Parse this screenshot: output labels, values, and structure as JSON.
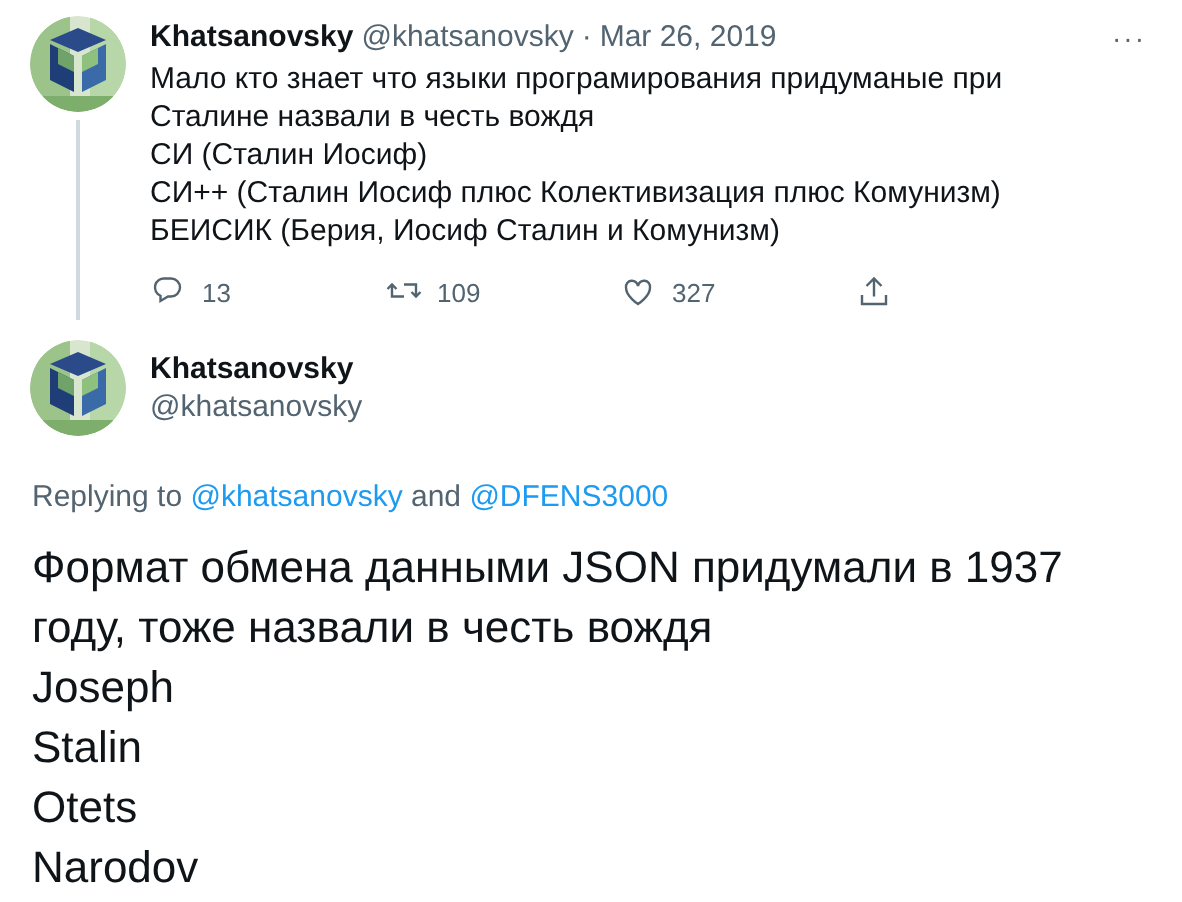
{
  "tweet": {
    "name": "Khatsanovsky",
    "handle": "@khatsanovsky",
    "separator": "·",
    "date": "Mar 26, 2019",
    "more": "···",
    "lines": [
      "Мало кто знает что языки програмирования придуманые при Сталине назвали в честь вождя",
      "СИ  (Сталин Иосиф)",
      "СИ++ (Сталин Иосиф плюс Колективизация плюс Комунизм)",
      "БЕИСИК (Берия, Иосиф Сталин и Комунизм)"
    ],
    "actions": [
      {
        "kind": "reply",
        "count": "13"
      },
      {
        "kind": "retweet",
        "count": "109"
      },
      {
        "kind": "like",
        "count": "327"
      },
      {
        "kind": "share"
      }
    ]
  },
  "reply": {
    "name": "Khatsanovsky",
    "handle": "@khatsanovsky",
    "replying_prefix": "Replying to",
    "mentions": [
      "@khatsanovsky",
      "@DFENS3000"
    ],
    "mention_joiner": "and",
    "lines": [
      "Формат обмена данными JSON придумали в 1937 году, тоже назвали в честь вождя",
      "Joseph",
      "Stalin",
      "Otets",
      "Narodov"
    ]
  }
}
